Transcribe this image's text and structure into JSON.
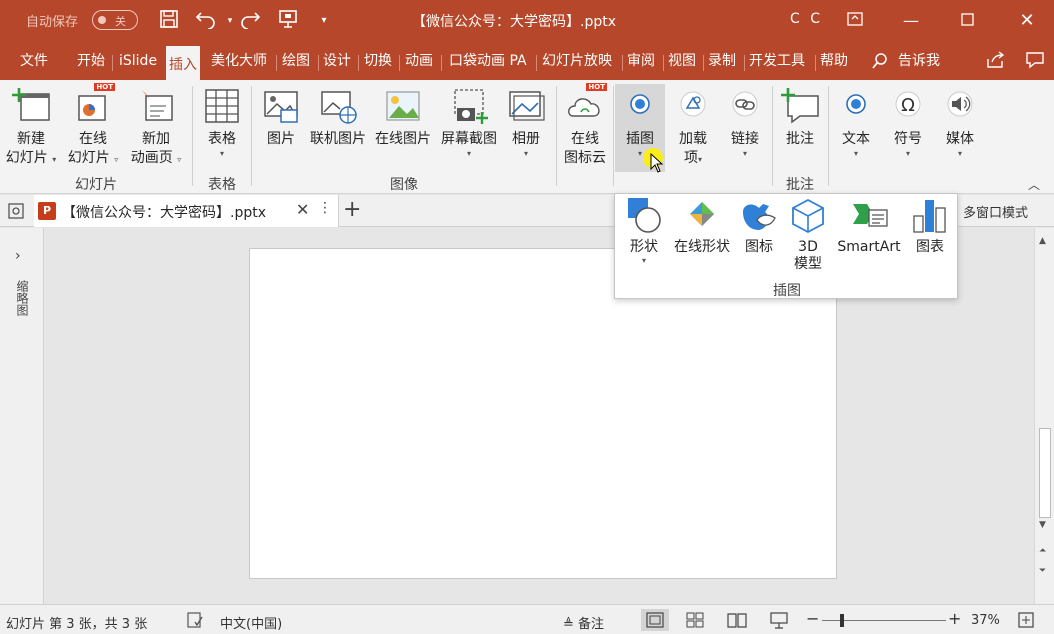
{
  "titlebar": {
    "autosave_label": "自动保存",
    "autosave_state": "关",
    "doc_title": "【微信公众号：大学密码】.pptx",
    "user": "C C"
  },
  "menu": {
    "tabs": [
      "文件",
      "开始",
      "iSlide",
      "插入",
      "美化大师",
      "绘图",
      "设计",
      "切换",
      "动画",
      "口袋动画 PA",
      "幻灯片放映",
      "审阅",
      "视图",
      "录制",
      "开发工具",
      "帮助"
    ],
    "active_index": 3,
    "tell_me": "告诉我"
  },
  "ribbon": {
    "buttons": {
      "new_slide": [
        "新建",
        "幻灯片"
      ],
      "online_slide": [
        "在线",
        "幻灯片"
      ],
      "new_anim": [
        "新加",
        "动画页"
      ],
      "table": "表格",
      "picture": "图片",
      "online_picture": "联机图片",
      "web_picture": "在线图片",
      "screenshot": "屏幕截图",
      "album": "相册",
      "online_icons": [
        "在线",
        "图标云"
      ],
      "illustrations": "插图",
      "addins": [
        "加载",
        "项"
      ],
      "links": "链接",
      "comment": "批注",
      "text": "文本",
      "symbols": "符号",
      "media": "媒体"
    },
    "groups": {
      "slides": "幻灯片",
      "tables": "表格",
      "images": "图像",
      "comments": "批注"
    },
    "hot_badge": "HOT"
  },
  "doctabs": {
    "tab_name": "【微信公众号：大学密码】.pptx",
    "multi_window": "多窗口模式"
  },
  "thumbnail_pane": {
    "label": "缩略图"
  },
  "dropdown": {
    "items": {
      "shapes": "形状",
      "online_shapes": "在线形状",
      "icons": "图标",
      "model3d": [
        "3D",
        "模型"
      ],
      "smartart": "SmartArt",
      "chart": "图表"
    },
    "group_label": "插图"
  },
  "statusbar": {
    "slide_info": "幻灯片 第 3 张，共 3 张",
    "language": "中文(中国)",
    "notes": "备注",
    "zoom": "37%"
  },
  "colors": {
    "accent": "#b7472a",
    "ribbon_bg": "#f3f3f3",
    "canvas_bg": "#e6e6e6"
  }
}
